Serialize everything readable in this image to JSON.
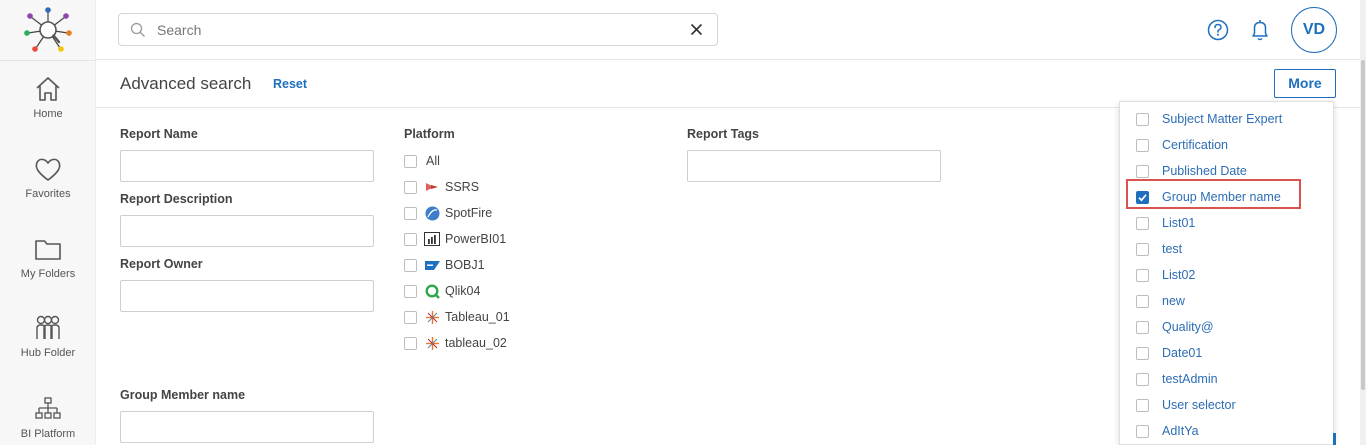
{
  "search": {
    "placeholder": "Search"
  },
  "header": {
    "avatar_initials": "VD"
  },
  "sidebar": {
    "items": [
      {
        "label": "Home",
        "icon": "home-icon"
      },
      {
        "label": "Favorites",
        "icon": "heart-icon"
      },
      {
        "label": "My Folders",
        "icon": "folder-icon"
      },
      {
        "label": "Hub Folder",
        "icon": "people-icon"
      },
      {
        "label": "BI Platform",
        "icon": "hierarchy-icon"
      }
    ]
  },
  "advanced": {
    "title": "Advanced search",
    "reset_label": "Reset",
    "more_label": "More"
  },
  "form": {
    "report_name_label": "Report Name",
    "report_description_label": "Report Description",
    "report_owner_label": "Report Owner",
    "group_member_label": "Group Member name",
    "platform_label": "Platform",
    "report_tags_label": "Report Tags",
    "platforms": [
      {
        "label": "All",
        "icon": ""
      },
      {
        "label": "SSRS",
        "icon": "ssrs-icon"
      },
      {
        "label": "SpotFire",
        "icon": "spotfire-icon"
      },
      {
        "label": "PowerBI01",
        "icon": "powerbi-icon"
      },
      {
        "label": "BOBJ1",
        "icon": "sap-icon"
      },
      {
        "label": "Qlik04",
        "icon": "qlik-icon"
      },
      {
        "label": "Tableau_01",
        "icon": "tableau-icon"
      },
      {
        "label": "tableau_02",
        "icon": "tableau-icon"
      }
    ]
  },
  "more_menu": {
    "items": [
      {
        "label": "Subject Matter Expert",
        "checked": false
      },
      {
        "label": "Certification",
        "checked": false
      },
      {
        "label": "Published Date",
        "checked": false
      },
      {
        "label": "Group Member name",
        "checked": true
      },
      {
        "label": "List01",
        "checked": false
      },
      {
        "label": "test",
        "checked": false
      },
      {
        "label": "List02",
        "checked": false
      },
      {
        "label": "new",
        "checked": false
      },
      {
        "label": "Quality@",
        "checked": false
      },
      {
        "label": "Date01",
        "checked": false
      },
      {
        "label": "testAdmin",
        "checked": false
      },
      {
        "label": "User selector",
        "checked": false
      },
      {
        "label": "AdItYa",
        "checked": false
      }
    ]
  },
  "colors": {
    "accent": "#1f6fbf",
    "highlight": "#d9534f"
  }
}
